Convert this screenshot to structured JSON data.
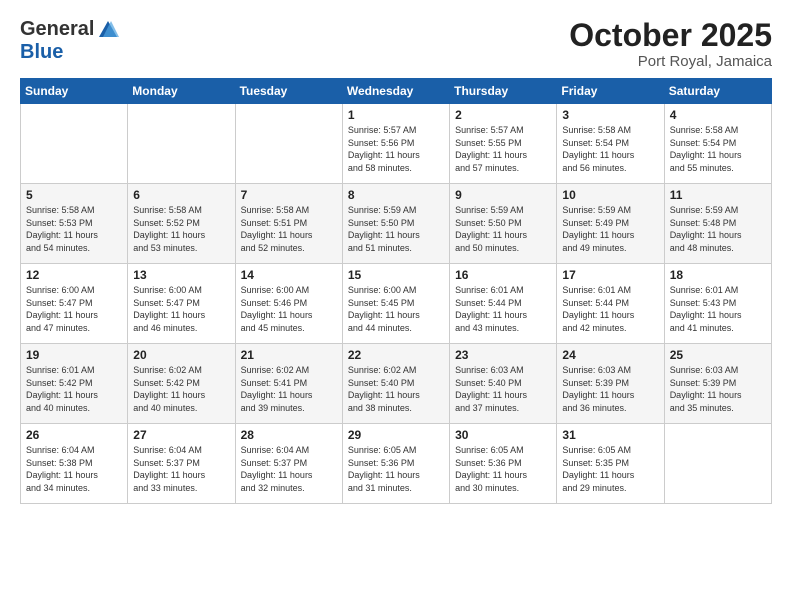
{
  "header": {
    "logo_general": "General",
    "logo_blue": "Blue",
    "month_title": "October 2025",
    "location": "Port Royal, Jamaica"
  },
  "days_of_week": [
    "Sunday",
    "Monday",
    "Tuesday",
    "Wednesday",
    "Thursday",
    "Friday",
    "Saturday"
  ],
  "weeks": [
    [
      {
        "num": "",
        "info": ""
      },
      {
        "num": "",
        "info": ""
      },
      {
        "num": "",
        "info": ""
      },
      {
        "num": "1",
        "info": "Sunrise: 5:57 AM\nSunset: 5:56 PM\nDaylight: 11 hours\nand 58 minutes."
      },
      {
        "num": "2",
        "info": "Sunrise: 5:57 AM\nSunset: 5:55 PM\nDaylight: 11 hours\nand 57 minutes."
      },
      {
        "num": "3",
        "info": "Sunrise: 5:58 AM\nSunset: 5:54 PM\nDaylight: 11 hours\nand 56 minutes."
      },
      {
        "num": "4",
        "info": "Sunrise: 5:58 AM\nSunset: 5:54 PM\nDaylight: 11 hours\nand 55 minutes."
      }
    ],
    [
      {
        "num": "5",
        "info": "Sunrise: 5:58 AM\nSunset: 5:53 PM\nDaylight: 11 hours\nand 54 minutes."
      },
      {
        "num": "6",
        "info": "Sunrise: 5:58 AM\nSunset: 5:52 PM\nDaylight: 11 hours\nand 53 minutes."
      },
      {
        "num": "7",
        "info": "Sunrise: 5:58 AM\nSunset: 5:51 PM\nDaylight: 11 hours\nand 52 minutes."
      },
      {
        "num": "8",
        "info": "Sunrise: 5:59 AM\nSunset: 5:50 PM\nDaylight: 11 hours\nand 51 minutes."
      },
      {
        "num": "9",
        "info": "Sunrise: 5:59 AM\nSunset: 5:50 PM\nDaylight: 11 hours\nand 50 minutes."
      },
      {
        "num": "10",
        "info": "Sunrise: 5:59 AM\nSunset: 5:49 PM\nDaylight: 11 hours\nand 49 minutes."
      },
      {
        "num": "11",
        "info": "Sunrise: 5:59 AM\nSunset: 5:48 PM\nDaylight: 11 hours\nand 48 minutes."
      }
    ],
    [
      {
        "num": "12",
        "info": "Sunrise: 6:00 AM\nSunset: 5:47 PM\nDaylight: 11 hours\nand 47 minutes."
      },
      {
        "num": "13",
        "info": "Sunrise: 6:00 AM\nSunset: 5:47 PM\nDaylight: 11 hours\nand 46 minutes."
      },
      {
        "num": "14",
        "info": "Sunrise: 6:00 AM\nSunset: 5:46 PM\nDaylight: 11 hours\nand 45 minutes."
      },
      {
        "num": "15",
        "info": "Sunrise: 6:00 AM\nSunset: 5:45 PM\nDaylight: 11 hours\nand 44 minutes."
      },
      {
        "num": "16",
        "info": "Sunrise: 6:01 AM\nSunset: 5:44 PM\nDaylight: 11 hours\nand 43 minutes."
      },
      {
        "num": "17",
        "info": "Sunrise: 6:01 AM\nSunset: 5:44 PM\nDaylight: 11 hours\nand 42 minutes."
      },
      {
        "num": "18",
        "info": "Sunrise: 6:01 AM\nSunset: 5:43 PM\nDaylight: 11 hours\nand 41 minutes."
      }
    ],
    [
      {
        "num": "19",
        "info": "Sunrise: 6:01 AM\nSunset: 5:42 PM\nDaylight: 11 hours\nand 40 minutes."
      },
      {
        "num": "20",
        "info": "Sunrise: 6:02 AM\nSunset: 5:42 PM\nDaylight: 11 hours\nand 40 minutes."
      },
      {
        "num": "21",
        "info": "Sunrise: 6:02 AM\nSunset: 5:41 PM\nDaylight: 11 hours\nand 39 minutes."
      },
      {
        "num": "22",
        "info": "Sunrise: 6:02 AM\nSunset: 5:40 PM\nDaylight: 11 hours\nand 38 minutes."
      },
      {
        "num": "23",
        "info": "Sunrise: 6:03 AM\nSunset: 5:40 PM\nDaylight: 11 hours\nand 37 minutes."
      },
      {
        "num": "24",
        "info": "Sunrise: 6:03 AM\nSunset: 5:39 PM\nDaylight: 11 hours\nand 36 minutes."
      },
      {
        "num": "25",
        "info": "Sunrise: 6:03 AM\nSunset: 5:39 PM\nDaylight: 11 hours\nand 35 minutes."
      }
    ],
    [
      {
        "num": "26",
        "info": "Sunrise: 6:04 AM\nSunset: 5:38 PM\nDaylight: 11 hours\nand 34 minutes."
      },
      {
        "num": "27",
        "info": "Sunrise: 6:04 AM\nSunset: 5:37 PM\nDaylight: 11 hours\nand 33 minutes."
      },
      {
        "num": "28",
        "info": "Sunrise: 6:04 AM\nSunset: 5:37 PM\nDaylight: 11 hours\nand 32 minutes."
      },
      {
        "num": "29",
        "info": "Sunrise: 6:05 AM\nSunset: 5:36 PM\nDaylight: 11 hours\nand 31 minutes."
      },
      {
        "num": "30",
        "info": "Sunrise: 6:05 AM\nSunset: 5:36 PM\nDaylight: 11 hours\nand 30 minutes."
      },
      {
        "num": "31",
        "info": "Sunrise: 6:05 AM\nSunset: 5:35 PM\nDaylight: 11 hours\nand 29 minutes."
      },
      {
        "num": "",
        "info": ""
      }
    ]
  ]
}
